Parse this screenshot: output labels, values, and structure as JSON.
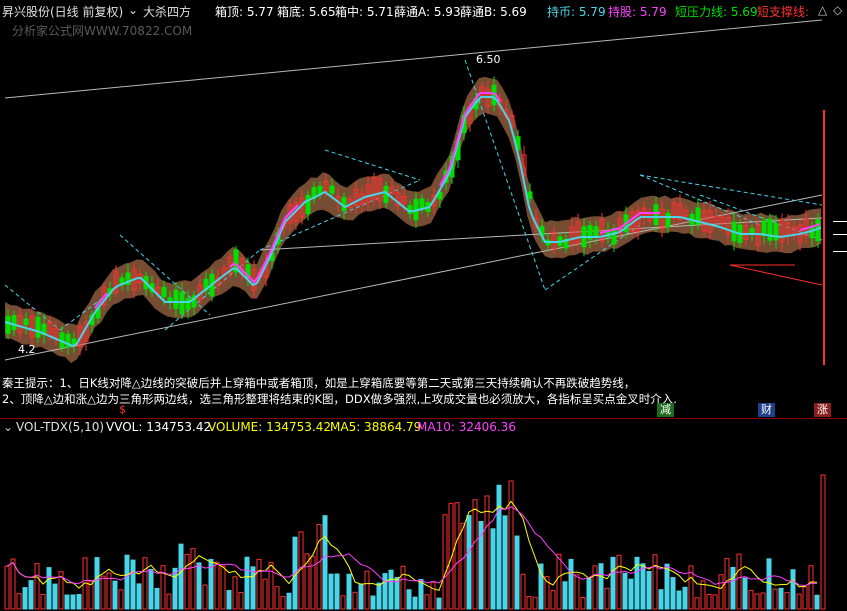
{
  "header": {
    "stock_name": "昇兴股份(日线 前复权)",
    "indicator_dropdown": "大杀四方",
    "box_top": "箱顶: 5.77",
    "box_bottom": "箱底: 5.65",
    "box_mid": "箱中: 5.71",
    "xue_a": "薛通A: 5.93",
    "xue_b": "薛通B: 5.69",
    "hold_coin": "持币: 5.79",
    "hold_stock": "持股: 5.79",
    "short_pressure": "短压力线: 5.69",
    "short_support": "短支撑线: "
  },
  "watermark": "分析家公式网WWW.70822.COM",
  "price_label": "6.50",
  "low_label": "4.2",
  "tips": {
    "line1": "秦王提示：1、日K线对降△边线的突破后并上穿箱中或者箱顶，如是上穿箱底要等第二天或第三天持续确认不再跌破趋势线，",
    "line2": "2、顶降△边和涨△边为三角形两边线，选三角形整理将结束的K图，DDX做多强烈,上攻成交量也必须放大，各指标呈买点金叉时介入."
  },
  "signals": {
    "s": "$",
    "jian": "减",
    "cai": "财",
    "zhang": "涨"
  },
  "volume": {
    "name": "VOL-TDX(5,10)",
    "vvol": "VVOL: 134753.42",
    "volume_val": "VOLUME: 134753.42",
    "ma5": "MA5: 38864.79",
    "ma10": "MA10: 32406.36"
  },
  "colors": {
    "up": "#ff3030",
    "down": "#00e000",
    "ma_cyan": "#4ad4e8",
    "ma_magenta": "#ff40ff",
    "band": "#8b5a3c",
    "vol_up": "#ff3030",
    "vol_down": "#4ad4e8",
    "ma5_line": "#ffff00",
    "ma10_line": "#ff40ff"
  }
}
